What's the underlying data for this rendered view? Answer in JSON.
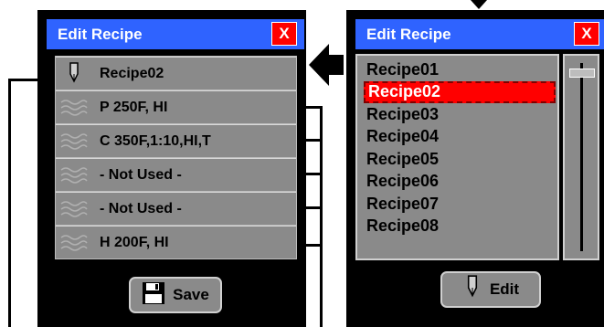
{
  "left_panel": {
    "title": "Edit Recipe",
    "close_label": "X",
    "steps": [
      {
        "label": "Recipe02",
        "icon": "pen-icon"
      },
      {
        "label": "P 250F, HI",
        "icon": "wave-icon"
      },
      {
        "label": "C 350F,1:10,HI,T",
        "icon": "wave-icon"
      },
      {
        "label": "- Not Used -",
        "icon": "wave-icon"
      },
      {
        "label": "- Not Used -",
        "icon": "wave-icon"
      },
      {
        "label": "H 200F, HI",
        "icon": "wave-icon"
      }
    ],
    "save_label": "Save"
  },
  "right_panel": {
    "title": "Edit Recipe",
    "close_label": "X",
    "recipes": [
      "Recipe01",
      "Recipe02",
      "Recipe03",
      "Recipe04",
      "Recipe05",
      "Recipe06",
      "Recipe07",
      "Recipe08"
    ],
    "selected_recipe": "Recipe02",
    "edit_label": "Edit"
  },
  "colors": {
    "title_bar": "#2f63ff",
    "close": "#ff0000",
    "selected": "#ff0000",
    "row": "#8a8a8a"
  }
}
